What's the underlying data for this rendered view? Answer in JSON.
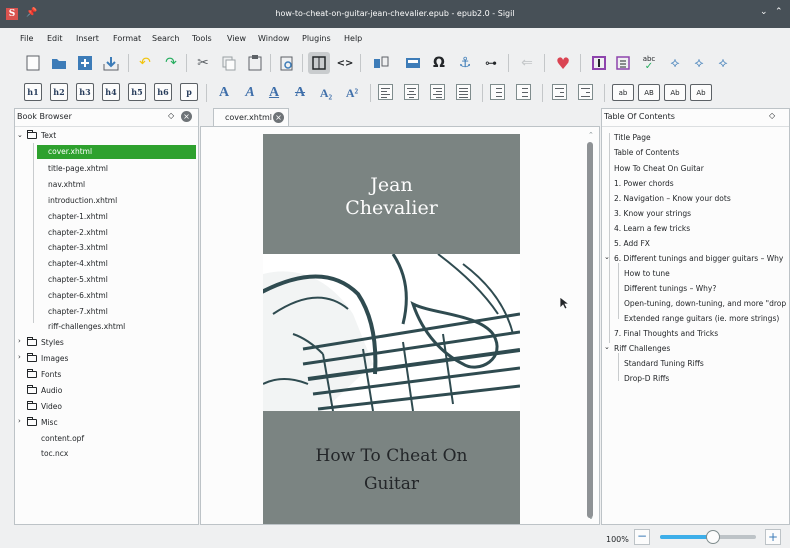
{
  "window": {
    "title": "how-to-cheat-on-guitar-jean-chevalier.epub - epub2.0 - Sigil",
    "app_icon": "S",
    "pin_icon": "📌",
    "minimize": "⌄",
    "maximize": "⌃"
  },
  "menu": [
    "File",
    "Edit",
    "Insert",
    "Format",
    "Search",
    "Tools",
    "View",
    "Window",
    "Plugins",
    "Help"
  ],
  "toolbar_row1": {
    "icons": [
      "new-file",
      "open-folder",
      "add-file",
      "save",
      "undo",
      "redo",
      "cut",
      "copy",
      "paste",
      "preview",
      "book-view",
      "code-view",
      "split",
      "metadata",
      "special-char",
      "anchor",
      "link",
      "back",
      "heart",
      "book",
      "toc",
      "spellcheck",
      "plugin1",
      "plugin2",
      "plugin3"
    ],
    "omega": "Ω",
    "anchor": "⚓",
    "link": "⊶",
    "back": "⇐",
    "heart": "♥",
    "code": "<>",
    "abc": "abc"
  },
  "toolbar_row2": {
    "headings": [
      "h1",
      "h2",
      "h3",
      "h4",
      "h5",
      "h6",
      "p"
    ],
    "text_styles": [
      "A",
      "A",
      "A",
      "A",
      "A₂",
      "A²"
    ],
    "case": [
      "ab",
      "AB",
      "Ab",
      "Ab"
    ]
  },
  "book_browser": {
    "title": "Book Browser",
    "folders": {
      "text": "Text",
      "styles": "Styles",
      "images": "Images",
      "fonts": "Fonts",
      "audio": "Audio",
      "video": "Video",
      "misc": "Misc"
    },
    "text_files": [
      "cover.xhtml",
      "title-page.xhtml",
      "nav.xhtml",
      "introduction.xhtml",
      "chapter-1.xhtml",
      "chapter-2.xhtml",
      "chapter-3.xhtml",
      "chapter-4.xhtml",
      "chapter-5.xhtml",
      "chapter-6.xhtml",
      "chapter-7.xhtml",
      "riff-challenges.xhtml"
    ],
    "selected": "cover.xhtml",
    "root_files": [
      "content.opf",
      "toc.ncx"
    ]
  },
  "editor": {
    "tab_label": "cover.xhtml",
    "cover_author_line1": "Jean",
    "cover_author_line2": "Chevalier",
    "cover_title_line1": "How To Cheat On",
    "cover_title_line2": "Guitar"
  },
  "toc": {
    "title": "Table Of Contents",
    "items": [
      {
        "label": "Title Page",
        "level": 0
      },
      {
        "label": "Table of Contents",
        "level": 0
      },
      {
        "label": "How To Cheat On Guitar",
        "level": 0
      },
      {
        "label": "1. Power chords",
        "level": 0
      },
      {
        "label": "2. Navigation – Know your dots",
        "level": 0
      },
      {
        "label": "3. Know your strings",
        "level": 0
      },
      {
        "label": "4. Learn a few tricks",
        "level": 0
      },
      {
        "label": "5. Add FX",
        "level": 0
      },
      {
        "label": "6. Different tunings and bigger guitars – Why",
        "level": 0,
        "expanded": true
      },
      {
        "label": "How to tune",
        "level": 1
      },
      {
        "label": "Different tunings – Why?",
        "level": 1
      },
      {
        "label": "Open-tuning, down-tuning, and more \"drop",
        "level": 1
      },
      {
        "label": "Extended range guitars (ie. more strings)",
        "level": 1
      },
      {
        "label": "7. Final Thoughts and Tricks",
        "level": 0
      },
      {
        "label": "Riff Challenges",
        "level": 0,
        "expanded": true
      },
      {
        "label": "Standard Tuning Riffs",
        "level": 1
      },
      {
        "label": "Drop-D Riffs",
        "level": 1
      }
    ]
  },
  "status": {
    "zoom": "100%",
    "zoom_level": 0.55
  }
}
